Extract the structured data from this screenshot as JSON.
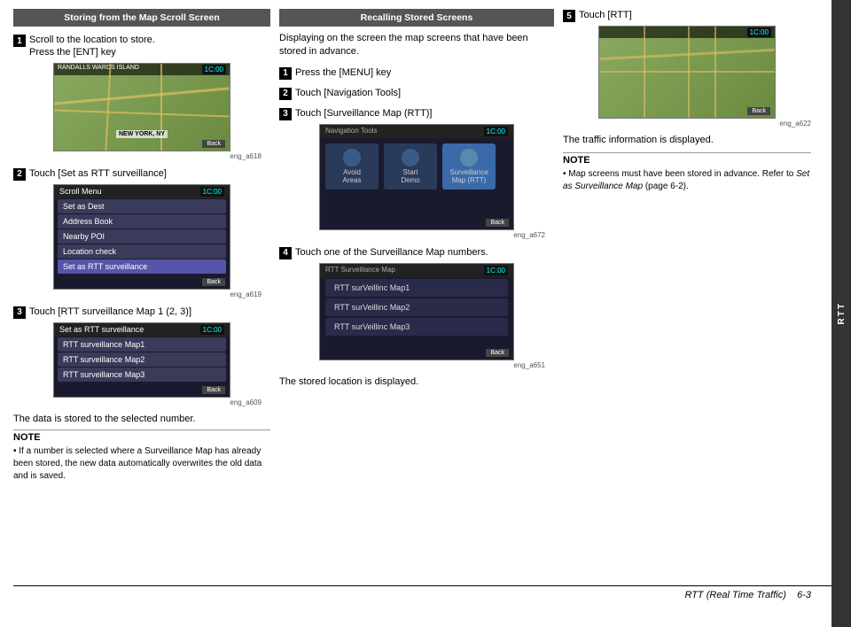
{
  "page": {
    "title": "RTT (Real Time Traffic)",
    "page_number": "6-3"
  },
  "left_section": {
    "header": "Storing from the Map Scroll Screen",
    "steps": [
      {
        "num": "1",
        "text": "Scroll to the location to store.\nPress the [ENT] key",
        "image_label": "eng_a618"
      },
      {
        "num": "2",
        "text": "Touch [Set as RTT surveillance]",
        "image_label": "eng_a619"
      },
      {
        "num": "3",
        "text": "Touch [RTT surveillance Map 1 (2, 3)]",
        "image_label": "eng_a609"
      }
    ],
    "after_steps_text": "The data is stored to the selected number.",
    "note_title": "NOTE",
    "note_text": "• If a number is selected where a Surveillance Map has already been stored, the new data automatically overwrites the old data and is saved.",
    "map_label": "NEW YORK, NY",
    "map_header": "RANDALLS WARDS ISLAND",
    "scroll_menu_title": "Scroll Menu",
    "scroll_menu_items": [
      "Set as Dest",
      "Address Book",
      "Nearby POI",
      "Location check",
      "Set as RTT surveillance"
    ],
    "rtt_surveillance_title": "Set as RTT surveillance",
    "rtt_surveillance_items": [
      "RTT surveillance Map1",
      "RTT surveillance Map2",
      "RTT surveillance Map3"
    ]
  },
  "middle_section": {
    "header": "Recalling Stored Screens",
    "intro": "Displaying on the screen the map screens that have been stored in advance.",
    "steps": [
      {
        "num": "1",
        "text": "Press the [MENU] key"
      },
      {
        "num": "2",
        "text": "Touch [Navigation Tools]"
      },
      {
        "num": "3",
        "text": "Touch [Surveillance Map (RTT)]",
        "image_label": "eng_a672"
      },
      {
        "num": "4",
        "text": "Touch one of the Surveillance Map numbers.",
        "image_label": "eng_a651"
      }
    ],
    "after_steps_text": "The stored location is displayed.",
    "nav_tools_title": "Navigation Tools",
    "nav_tools_items": [
      "Avoid Areas",
      "Start Demo",
      "Surveillance Map (RTT)"
    ],
    "rtt_map_title": "RTT Surveillance Map",
    "rtt_map_items": [
      "RTT surVeillinc Map1",
      "RTT surVeillinc Map2",
      "RTT surVeillinc Map3"
    ]
  },
  "right_section": {
    "step": {
      "num": "5",
      "text": "Touch [RTT]",
      "image_label": "eng_a622"
    },
    "after_text": "The traffic information is displayed.",
    "note_title": "NOTE",
    "note_text": "• Map screens must have been stored in advance. Refer to \"Set as Surveillance Map\" (page 6-2).",
    "note_italic": "Set as Surveillance Map"
  },
  "sidebar": {
    "label": "RTT"
  },
  "footer": {
    "text": "RTT (Real Time Traffic)",
    "page": "6-3"
  },
  "time_display": "1C:00",
  "back_label": "Back"
}
